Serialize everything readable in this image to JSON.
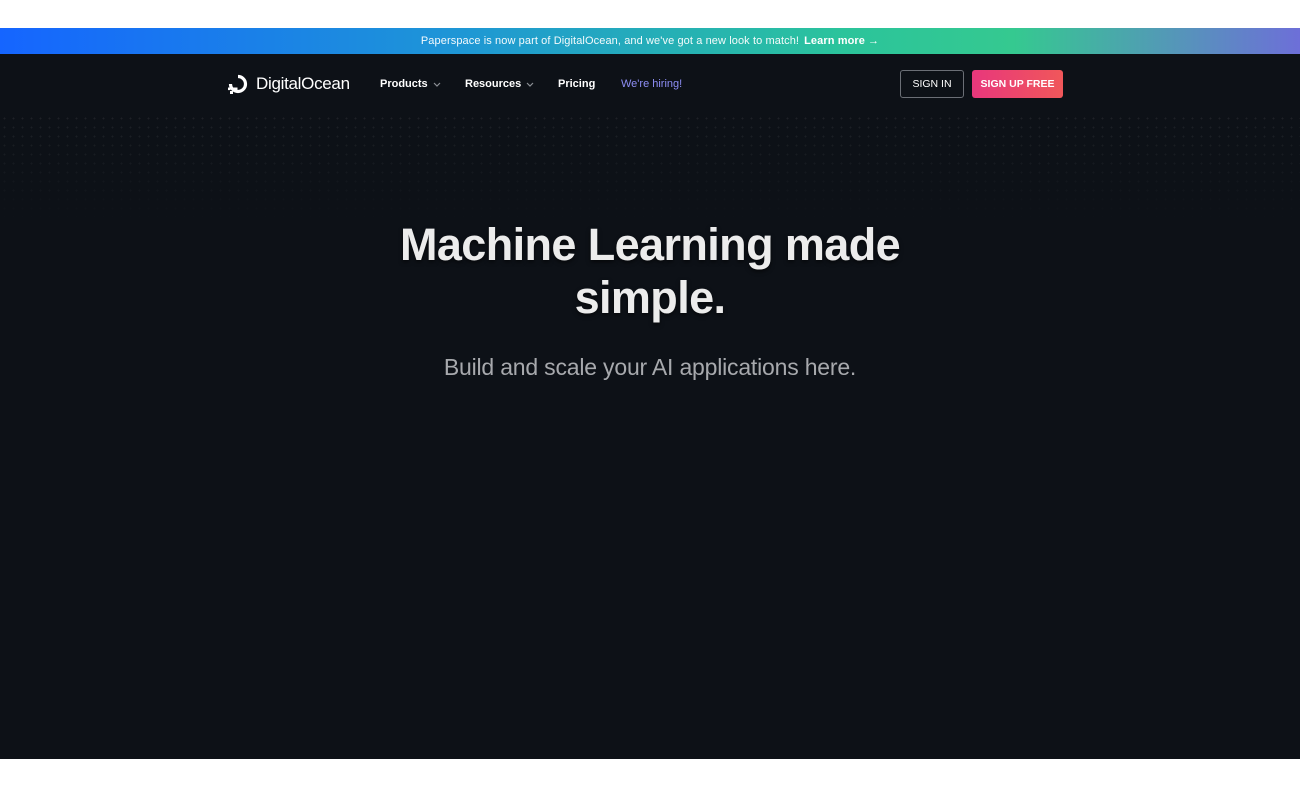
{
  "announcement": {
    "message": "Paperspace is now part of DigitalOcean, and we've got a new look to match!",
    "link_label": "Learn more",
    "arrow_icon": "arrow-right-icon"
  },
  "nav": {
    "logo_text": "DigitalOcean",
    "logo_icon": "digitalocean-logo-icon",
    "items": [
      {
        "label": "Products",
        "has_dropdown": true
      },
      {
        "label": "Resources",
        "has_dropdown": true
      },
      {
        "label": "Pricing",
        "has_dropdown": false
      },
      {
        "label": "We're hiring!",
        "has_dropdown": false
      }
    ],
    "signin_label": "SIGN IN",
    "signup_label": "SIGN UP FREE"
  },
  "hero": {
    "title": "Machine Learning made simple.",
    "subtitle": "Build and scale your AI applications here."
  },
  "colors": {
    "background": "#0d1117",
    "hiring_link": "#8e8ef5",
    "signup_start": "#e8377c",
    "signup_end": "#f0575a",
    "banner_start": "#1565ff",
    "banner_mid": "#2bc49b",
    "banner_end": "#6d6fd8"
  }
}
